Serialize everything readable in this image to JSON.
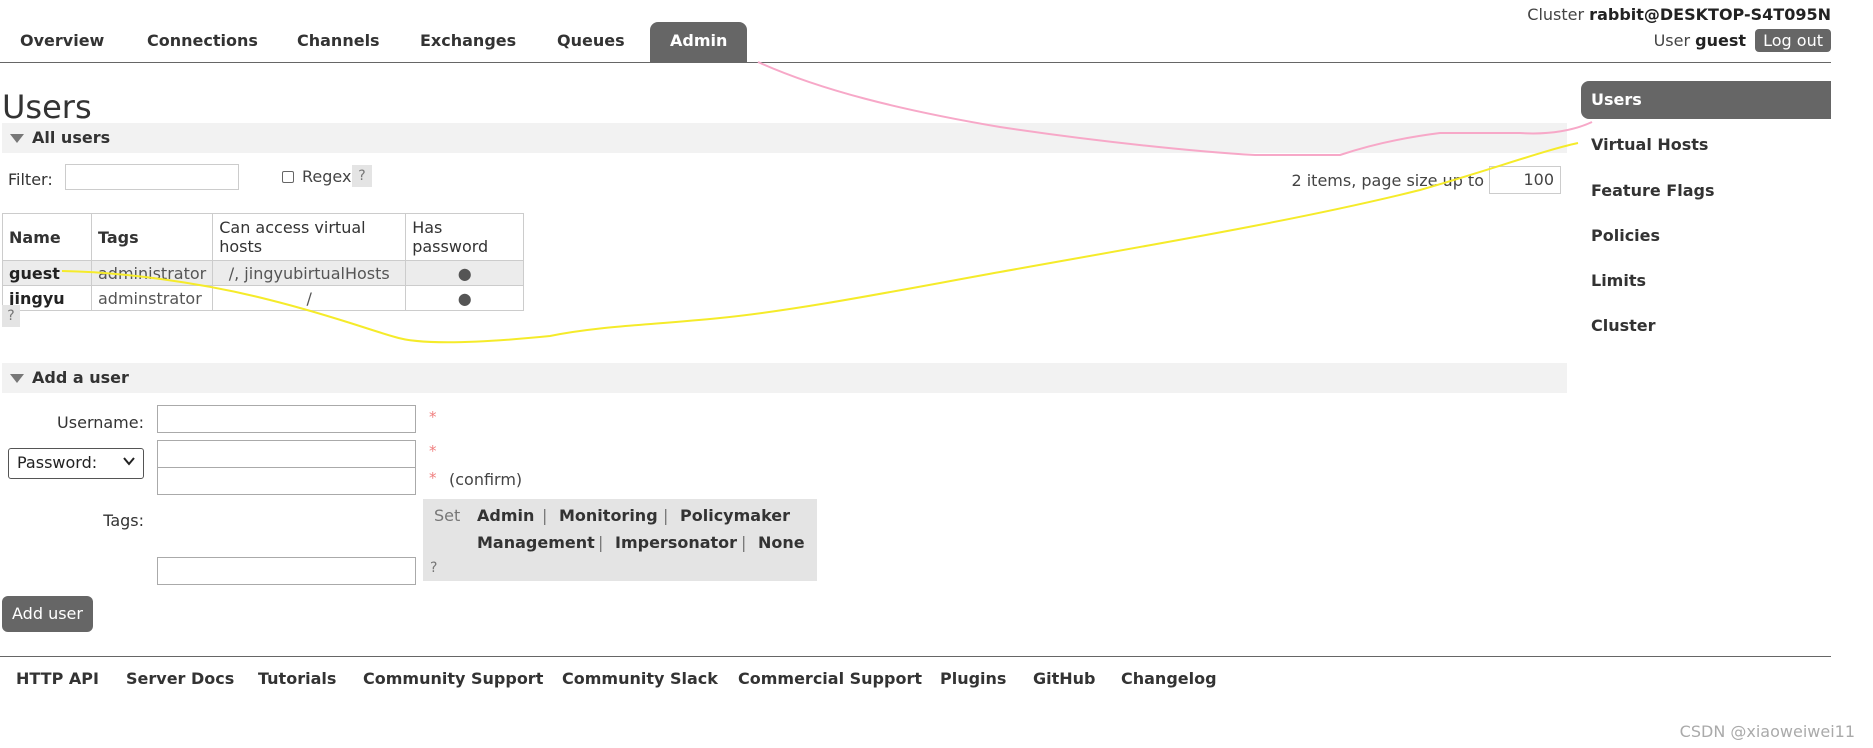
{
  "nav": {
    "tabs": [
      {
        "label": "Overview"
      },
      {
        "label": "Connections"
      },
      {
        "label": "Channels"
      },
      {
        "label": "Exchanges"
      },
      {
        "label": "Queues"
      },
      {
        "label": "Admin",
        "active": true
      }
    ]
  },
  "header": {
    "cluster_prefix": "Cluster",
    "cluster_name": "rabbit@DESKTOP-S4T095N",
    "user_prefix": "User",
    "user_name": "guest",
    "logout_label": "Log out"
  },
  "page": {
    "title": "Users"
  },
  "all_users": {
    "heading": "All users",
    "filter_label": "Filter:",
    "filter_value": "",
    "regex_label": "Regex",
    "regex_checked": false,
    "help": "?",
    "items_text": "2 items, page size up to",
    "page_size": "100",
    "columns": [
      "Name",
      "Tags",
      "Can access virtual hosts",
      "Has password"
    ],
    "rows": [
      {
        "name": "guest",
        "tags": "administrator",
        "vhosts": "/, jingyubirtualHosts",
        "has_password": "●"
      },
      {
        "name": "jingyu",
        "tags": "adminstrator",
        "vhosts": "/",
        "has_password": "●"
      }
    ]
  },
  "add_user": {
    "heading": "Add a user",
    "username_label": "Username:",
    "password_select": "Password:",
    "required_mark": "*",
    "confirm_label": "(confirm)",
    "tags_label": "Tags:",
    "set_label": "Set",
    "tag_options": [
      "Admin",
      "Monitoring",
      "Policymaker",
      "Management",
      "Impersonator",
      "None"
    ],
    "separator": "|",
    "help": "?",
    "button_label": "Add user"
  },
  "sidebar": {
    "items": [
      {
        "label": "Users",
        "active": true
      },
      {
        "label": "Virtual Hosts"
      },
      {
        "label": "Feature Flags"
      },
      {
        "label": "Policies"
      },
      {
        "label": "Limits"
      },
      {
        "label": "Cluster"
      }
    ]
  },
  "footer": {
    "links": [
      "HTTP API",
      "Server Docs",
      "Tutorials",
      "Community Support",
      "Community Slack",
      "Commercial Support",
      "Plugins",
      "GitHub",
      "Changelog"
    ]
  },
  "watermark": "CSDN @xiaoweiwei11",
  "colors": {
    "accent": "#666666",
    "annotation_pink": "#f7a8c8",
    "annotation_yellow": "#f5eb2a",
    "required": "#f08080"
  }
}
